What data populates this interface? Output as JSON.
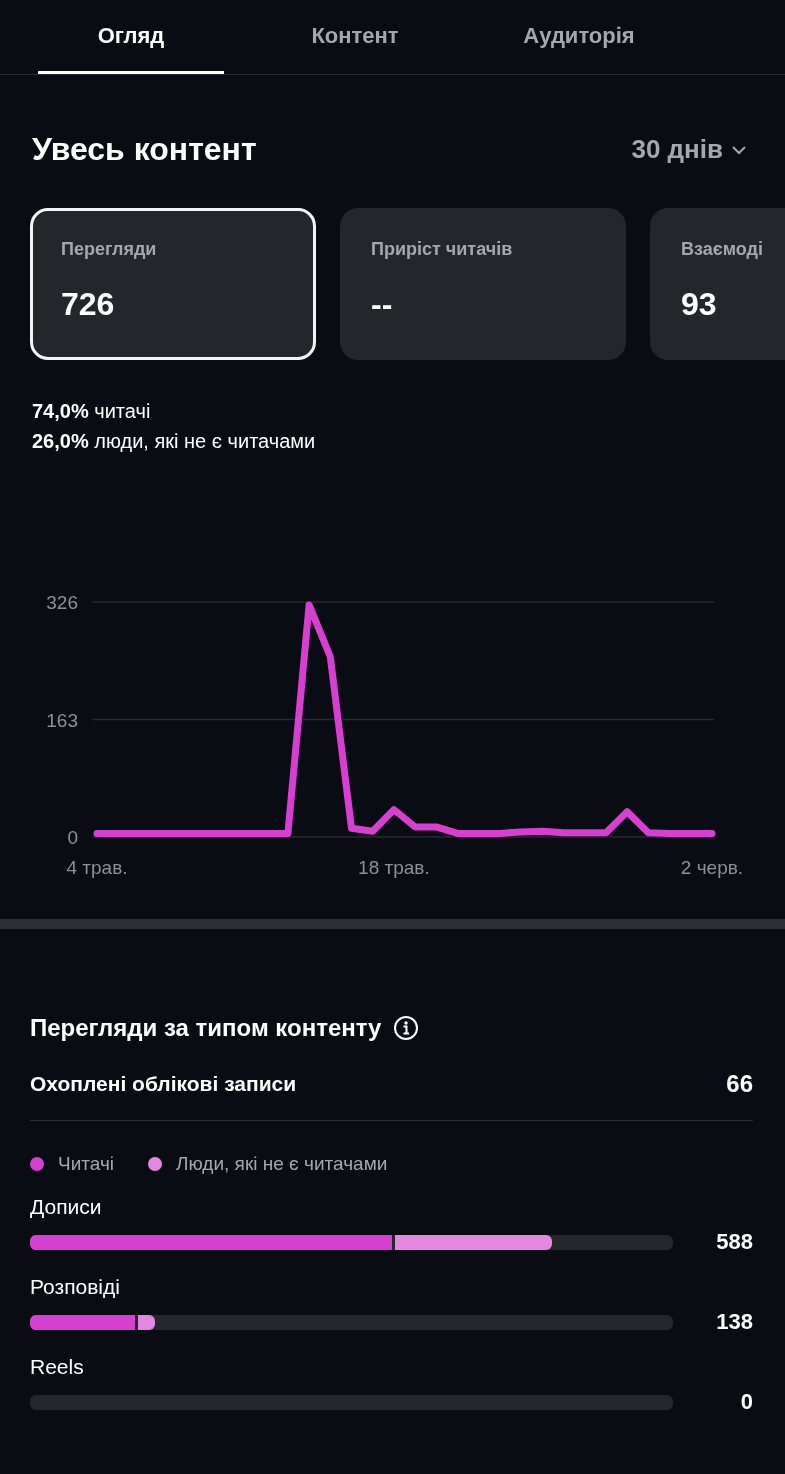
{
  "tabs": [
    {
      "label": "Огляд",
      "selected": true
    },
    {
      "label": "Контент",
      "selected": false
    },
    {
      "label": "Аудиторія",
      "selected": false
    }
  ],
  "header": {
    "title": "Увесь контент",
    "period": "30 днів"
  },
  "cards": [
    {
      "label": "Перегляди",
      "value": "726",
      "selected": true
    },
    {
      "label": "Приріст читачів",
      "value": "--",
      "selected": false
    },
    {
      "label": "Взаємоді",
      "value": "93",
      "selected": false
    }
  ],
  "breakdown": [
    {
      "percent": "74,0%",
      "label": "читачі"
    },
    {
      "percent": "26,0%",
      "label": "люди, які не є читачами"
    }
  ],
  "chart_data": {
    "type": "line",
    "categories": [
      "4 трав.",
      null,
      null,
      null,
      null,
      null,
      null,
      null,
      null,
      null,
      null,
      null,
      null,
      null,
      "18 трав.",
      null,
      null,
      null,
      null,
      null,
      null,
      null,
      null,
      null,
      null,
      null,
      null,
      null,
      null,
      "2 черв."
    ],
    "series": [
      {
        "color": "#d63fd0",
        "values": [
          5,
          5,
          5,
          5,
          5,
          5,
          5,
          5,
          5,
          5,
          322,
          250,
          12,
          8,
          38,
          14,
          14,
          5,
          5,
          5,
          7,
          8,
          6,
          6,
          6,
          35,
          6,
          5,
          5,
          5
        ]
      }
    ],
    "yticks": [
      0,
      163,
      326
    ],
    "ylim": [
      0,
      326
    ]
  },
  "content_types": {
    "title": "Перегляди за типом контенту",
    "accounts": {
      "label": "Охоплені облікові записи",
      "value": "66"
    },
    "legend": [
      {
        "label": "Читачі",
        "color": "#d63fd0"
      },
      {
        "label": "Люди, які не є читачами",
        "color": "#e487e0"
      }
    ],
    "bars": [
      {
        "label": "Дописи",
        "value": "588",
        "level": 0.812,
        "readers": {
          "level": 0.568
        }
      },
      {
        "label": "Розповіді",
        "value": "138",
        "level": 0.194,
        "readers": {
          "level": 0.168
        }
      },
      {
        "label": "Reels",
        "value": "0",
        "level": 0
      }
    ]
  }
}
